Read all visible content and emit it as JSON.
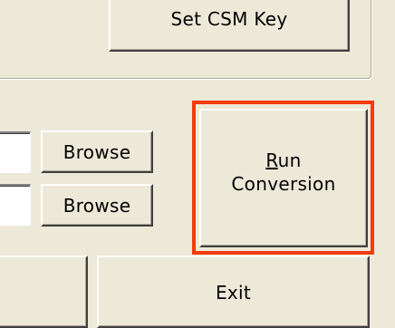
{
  "buttons": {
    "set_csm_key": "Set CSM Key",
    "browse_1": "Browse",
    "browse_2": "Browse",
    "run_conversion": {
      "mnemonic": "R",
      "line1_rest": "un",
      "line2": "Conversion"
    },
    "exit": "Exit"
  },
  "colors": {
    "face": "#ece9d8",
    "highlight": "#f23b0f"
  }
}
